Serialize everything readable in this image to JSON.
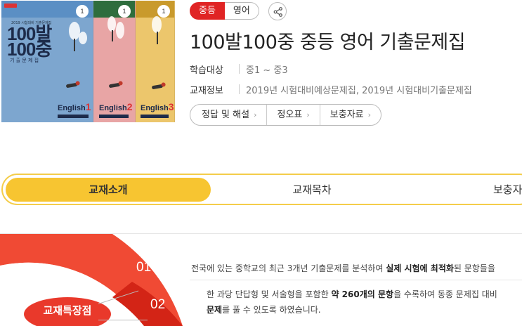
{
  "covers": [
    {
      "title": "100발 100중",
      "subtitle": "기 출 문 제 집",
      "english": "English",
      "vol": "1"
    },
    {
      "english": "English",
      "vol": "2"
    },
    {
      "english": "English",
      "vol": "3"
    }
  ],
  "tags": [
    "중등",
    "영어"
  ],
  "title": "100발100중 중등 영어 기출문제집",
  "info": [
    {
      "key": "학습대상",
      "value": "중1 ~ 중3"
    },
    {
      "key": "교재정보",
      "value": "2019년 시험대비예상문제집, 2019년 시험대비기출문제집"
    }
  ],
  "buttons": [
    "정답 및 해설",
    "정오표",
    "보충자료"
  ],
  "chevron": "›",
  "tabs": [
    "교재소개",
    "교재목차",
    "보충자료"
  ],
  "features": {
    "label": "교재특장점",
    "items": [
      {
        "num": "01",
        "pre": "전국에 있는 중학교의 최근 3개년 기출문제를 분석하여 ",
        "bold": "실제 시험에 최적화",
        "post": "된 문항들을"
      },
      {
        "num": "02",
        "pre": "한 과당 단답형 및 서술형을 포함한 ",
        "bold": "약 260개의 문항",
        "post": "을 수록하여 동종 문제집 대비",
        "line2_bold": "문제",
        "line2_post": "를 풀 수 있도록 하였습니다."
      }
    ]
  },
  "colors": {
    "accent": "#e02424",
    "tab_active": "#f7c531",
    "feature_red": "#e9392b"
  }
}
